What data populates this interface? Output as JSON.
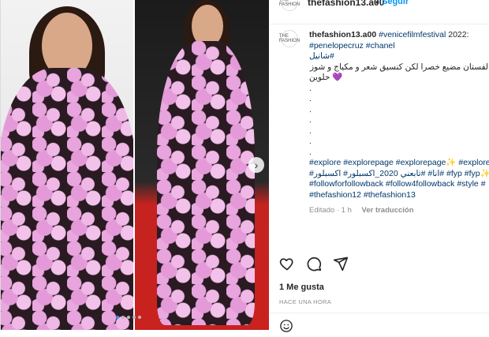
{
  "header": {
    "username": "thefashion13.a00",
    "separator": "•",
    "follow_label": "Seguir",
    "avatar_text": "THE FASHION"
  },
  "caption": {
    "username": "thefashion13.a00",
    "line1_tags": "#venicefilmfestival",
    "line1_year": " 2022:",
    "line2_tags": "#penelopecruz #chanel",
    "line3_ar": "شانيل#",
    "line4_ar": "الفستان مضيع خصرا لكن كنسيق شعر و مكياج و شوز",
    "line5_ar": "حلوين 💜",
    "dots": [
      ".",
      ".",
      ".",
      ".",
      ".",
      ".",
      "."
    ],
    "tags1": "#explore #explorepage #explorepage✨ #explore",
    "tags2": "#انا# #تابعني 2020_اكسبلور# اكسبلور# #fyp #fyp✨",
    "tags3": "#followforfollowback #follow4followback #style #",
    "tags4": "#thefashion12 #thefashion13",
    "edited": "Editado · 1 h",
    "see_translation": "Ver traducción"
  },
  "likes": "1 Me gusta",
  "timestamp": "HACE UNA HORA",
  "carousel": {
    "dots_count": 5,
    "active_index": 0
  },
  "colors": {
    "accent": "#0095f6",
    "link": "#00376b",
    "muted": "#8e8e8e",
    "carpet": "#c9221f"
  }
}
